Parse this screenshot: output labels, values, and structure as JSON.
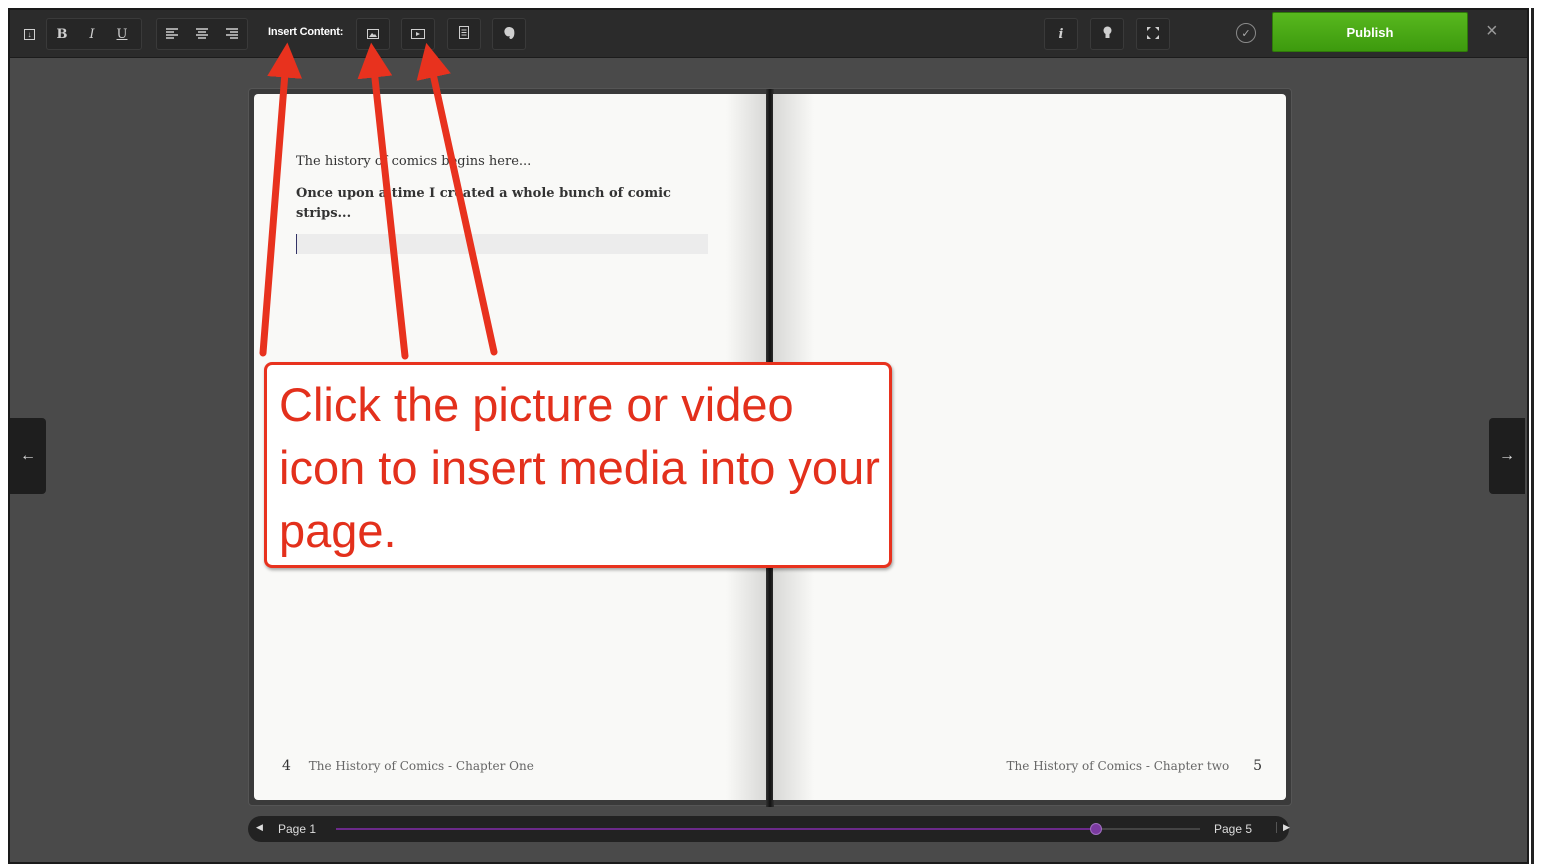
{
  "toolbar": {
    "format_buttons": [
      "B",
      "I",
      "U"
    ],
    "insert_label": "Insert Content:",
    "publish_label": "Publish",
    "info_label": "i",
    "close_label": "×",
    "check_label": "✓"
  },
  "book": {
    "left_page": {
      "intro_text": "The history of comics begins here...",
      "bold_text": "Once upon a time I created a whole bunch of comic strips...",
      "page_number": "4",
      "chapter_title": "The History of Comics - Chapter One"
    },
    "right_page": {
      "page_number": "5",
      "chapter_title": "The History of Comics - Chapter two"
    }
  },
  "navigation": {
    "prev_arrow": "←",
    "next_arrow": "→"
  },
  "page_slider": {
    "from_label": "Page 1",
    "to_label": "Page 5",
    "position": 0.88
  },
  "annotation": {
    "text": "Click the picture or video icon to insert media into your page.",
    "color": "#e8321e"
  }
}
